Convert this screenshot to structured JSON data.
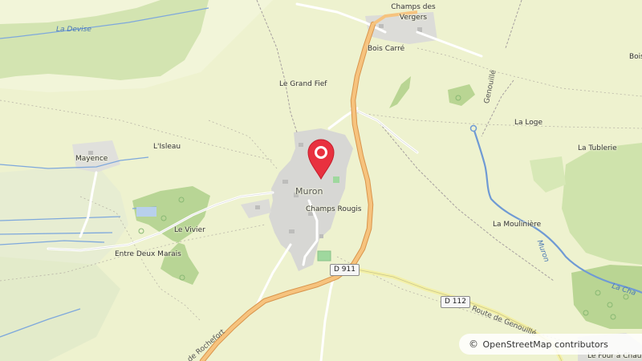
{
  "map": {
    "places": {
      "champs_des_vergers": "Champs des Vergers",
      "bois_carre": "Bois Carré",
      "le_grand_fief": "Le Grand Fief",
      "la_loge": "La Loge",
      "la_tublerie": "La Tublerie",
      "lisleau": "L'Isleau",
      "mayence": "Mayence",
      "muron": "Muron",
      "champs_rougis": "Champs Rougis",
      "le_vivier": "Le Vivier",
      "entre_deux_marais": "Entre Deux Marais",
      "la_mouliniere": "La Moulinière",
      "le_four_a_chaux": "Le Four à Chau",
      "bois_edge": "Bois"
    },
    "waterways": {
      "la_devise": "La Devise",
      "muron_stream": "Muron",
      "la_chanal": "La Cha"
    },
    "roads": {
      "genouille": "Genouillé",
      "route_de_genouille": "Route de Genouillé",
      "route_de_rochefort": "de Rochefort"
    },
    "shields": {
      "d911": "D 911",
      "d112": "D 112"
    },
    "colors": {
      "background": "#eef2cf",
      "forest": "#c8dea8",
      "built_up": "#d6d6d6",
      "water": "#7ea8dc",
      "main_road": "#f2b86a",
      "marker": "#e8313f"
    }
  },
  "marker": {
    "icon": "map-pin-icon"
  },
  "attribution": {
    "symbol": "©",
    "text": "OpenStreetMap contributors"
  }
}
